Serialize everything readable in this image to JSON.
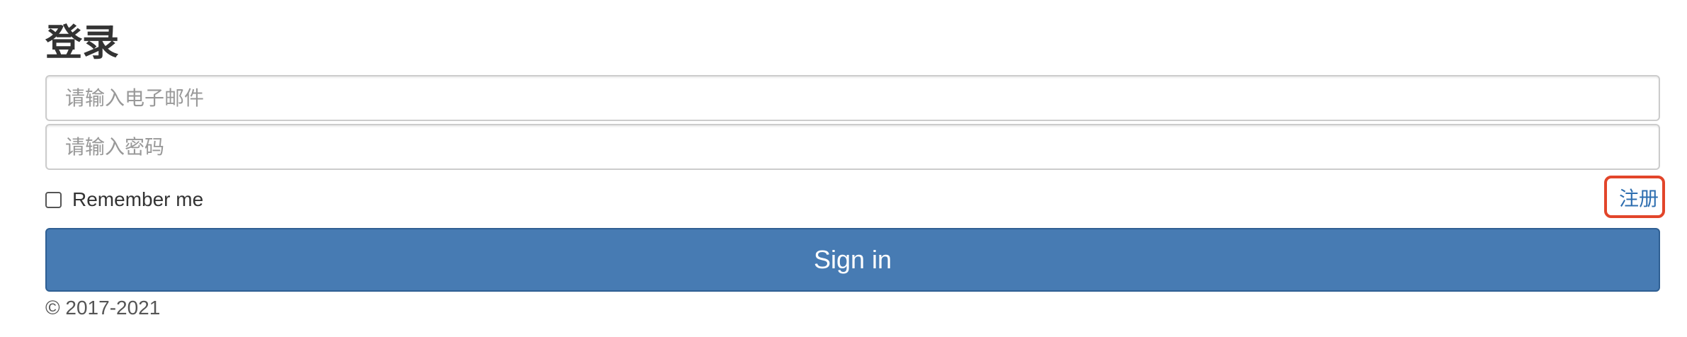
{
  "form": {
    "title": "登录",
    "email_placeholder": "请输入电子邮件",
    "password_placeholder": "请输入密码",
    "remember_label": "Remember me",
    "register_link": "注册",
    "signin_label": "Sign in"
  },
  "footer": {
    "copyright": "© 2017-2021"
  },
  "colors": {
    "primary_button": "#477bb3",
    "link": "#2f6fb0",
    "highlight_box": "#e2452a"
  }
}
